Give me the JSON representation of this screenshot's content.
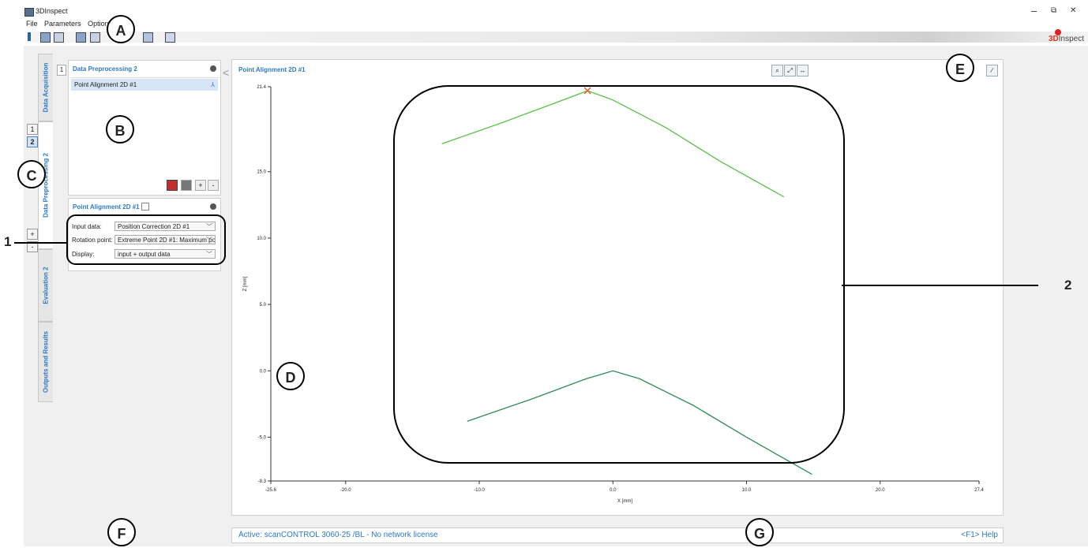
{
  "window": {
    "title": "3DInspect",
    "minimize": "–",
    "restore": "⧉",
    "close": "✕"
  },
  "menu": [
    "File",
    "Parameters",
    "Option"
  ],
  "brand": {
    "prefix": "3D",
    "rest": "Inspect"
  },
  "vertical_tabs": [
    "Data Acquisition",
    "Data Preprocessing 2",
    "Evaluation 2",
    "Outputs and Results"
  ],
  "step_buttons": [
    "1",
    "2"
  ],
  "panel_number": "1",
  "plus_minus": [
    "+",
    "-"
  ],
  "preprocessing_panel": {
    "title": "Data Preprocessing 2",
    "items": [
      "Point Alignment 2D #1"
    ],
    "buttons": [
      "+",
      "-"
    ]
  },
  "properties_panel": {
    "title": "Point Alignment 2D #1",
    "fields": [
      {
        "label": "Input data:",
        "value": "Position Correction 2D #1"
      },
      {
        "label": "Rotation point:",
        "value": "Extreme Point 2D #1: Maximum point"
      },
      {
        "label": "Display:",
        "value": "input + output data"
      }
    ]
  },
  "plot": {
    "title": "Point Alignment 2D #1"
  },
  "chart_data": {
    "type": "line",
    "title": "Point Alignment 2D #1",
    "xlabel": "X [mm]",
    "ylabel": "Z [mm]",
    "xlim": [
      -25.6,
      27.4
    ],
    "ylim": [
      -8.3,
      21.4
    ],
    "x_ticks": [
      "-25.6",
      "-20.0",
      "-10.0",
      "0.0",
      "10.0",
      "20.0",
      "27.4"
    ],
    "y_ticks": [
      "21.4",
      "15.0",
      "10.0",
      "5.0",
      "0.0",
      "-5.0",
      "-8.3"
    ],
    "grid": false,
    "series": [
      {
        "color": "#5cbf4a",
        "x": [
          -12.8,
          -8,
          -4,
          -1.9,
          0,
          4,
          8,
          12.8
        ],
        "y": [
          17.1,
          18.8,
          20.3,
          21.1,
          20.4,
          18.3,
          15.8,
          13.1
        ]
      },
      {
        "color": "#2e8b57",
        "x": [
          -10.9,
          -6,
          -2,
          0,
          2,
          6,
          10,
          14.9
        ],
        "y": [
          -3.8,
          -2.1,
          -0.6,
          0.0,
          -0.6,
          -2.6,
          -5.0,
          -7.8
        ]
      }
    ],
    "markers": [
      {
        "x": -1.9,
        "y": 21.1,
        "symbol": "x",
        "color": "#e85a2a"
      }
    ]
  },
  "status": {
    "text": "Active: scanCONTROL 3060-25 /BL - No network license",
    "help": "<F1> Help"
  },
  "callouts": [
    "A",
    "B",
    "C",
    "D",
    "E",
    "F",
    "G"
  ],
  "number_labels": [
    "1",
    "2"
  ]
}
